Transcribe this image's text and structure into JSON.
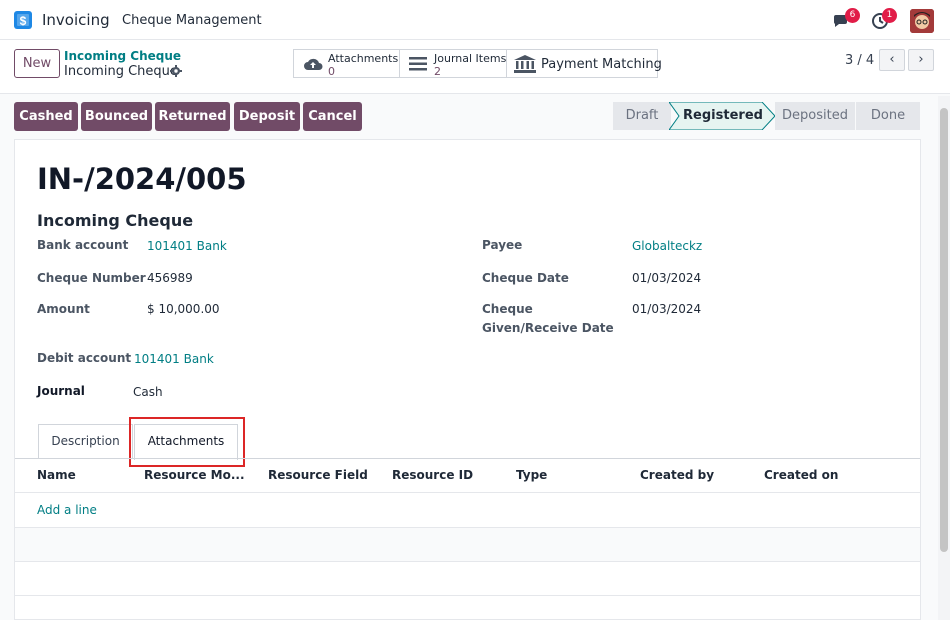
{
  "navbar": {
    "app_name": "Invoicing",
    "menu": "Cheque Management",
    "messages_count": "6",
    "activities_count": "1"
  },
  "control_panel": {
    "new_label": "New",
    "breadcrumb_link": "Incoming Cheque",
    "breadcrumb_current": "Incoming Cheque",
    "smart_buttons": [
      {
        "label": "Attachments",
        "count": "0"
      },
      {
        "label": "Journal Items",
        "count": "2"
      },
      {
        "label": "Payment Matching",
        "count": ""
      }
    ],
    "pager": "3 / 4"
  },
  "actions": [
    "Cashed",
    "Bounced",
    "Returned",
    "Deposit",
    "Cancel"
  ],
  "statusbar": [
    "Draft",
    "Registered",
    "Deposited",
    "Done"
  ],
  "status_active": "Registered",
  "record": {
    "name": "IN-/2024/005",
    "type": "Incoming Cheque",
    "fields_left": [
      {
        "label": "Bank account",
        "value": "101401 Bank"
      },
      {
        "label": "Cheque Number",
        "value": "456989"
      },
      {
        "label": "Amount",
        "value": "$ 10,000.00"
      },
      {
        "label": "Debit account",
        "value": "101401 Bank"
      },
      {
        "label": "Journal",
        "value": "Cash"
      }
    ],
    "fields_right": [
      {
        "label": "Payee",
        "value": "Globalteckz"
      },
      {
        "label": "Cheque Date",
        "value": "01/03/2024"
      },
      {
        "label": "Cheque Given/Receive Date",
        "value": "01/03/2024"
      }
    ]
  },
  "tabs": [
    "Description",
    "Attachments"
  ],
  "active_tab": "Attachments",
  "table": {
    "columns": [
      "Name",
      "Resource Mo...",
      "Resource Field",
      "Resource ID",
      "Type",
      "Created by",
      "Created on"
    ],
    "add_line": "Add a line"
  },
  "colors": {
    "primary": "#714b67",
    "link": "#017e84",
    "highlight": "#dc2626"
  }
}
